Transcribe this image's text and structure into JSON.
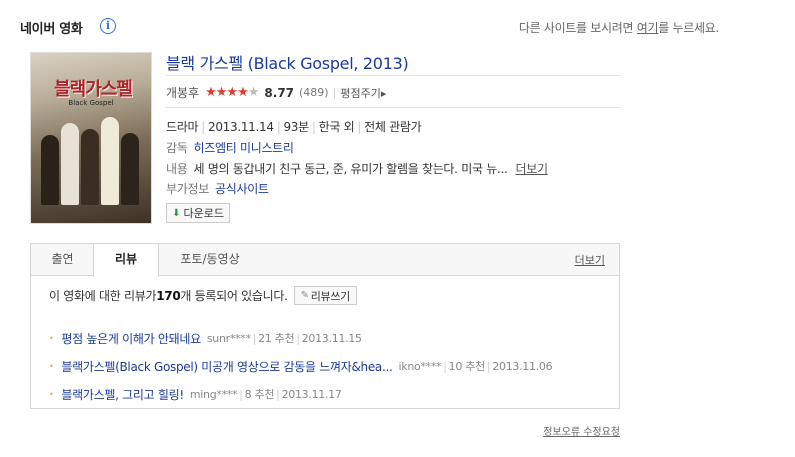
{
  "header": {
    "title": "네이버 영화",
    "info_icon": "i",
    "right_prefix": "다른 사이트를 보시려면 ",
    "right_link": "여기",
    "right_suffix": "를 누르세요."
  },
  "poster": {
    "title": "블랙가스펠",
    "subtitle": "Black Gospel"
  },
  "movie": {
    "title": "블랙 가스펠 (Black Gospel, 2013)",
    "status": "개봉후",
    "stars": "★★★★",
    "half_star": "★",
    "score": "8.77",
    "rating_count": "(489)",
    "rate_link": "평점주기",
    "rate_arrow": "▸",
    "genre": "드라마",
    "release": "2013.11.14",
    "runtime": "93분",
    "country": "한국 외",
    "age": "전체 관람가",
    "director_label": "감독",
    "director": "히즈엠티 미니스트리",
    "summary_label": "내용",
    "summary": "세 명의 동갑내기 친구 동근, 준, 유미가 할렘을 찾는다. 미국 뉴...",
    "summary_more": "더보기",
    "extra_label": "부가정보",
    "extra_link": "공식사이트",
    "download_label": "다운로드",
    "download_icon": "⬇"
  },
  "tabs": {
    "items": [
      "출연",
      "리뷰",
      "포토/동영상"
    ],
    "more": "더보기"
  },
  "reviews": {
    "count_prefix": "이 영화에 대한 리뷰가 ",
    "count": "170",
    "count_suffix": "개 등록되어 있습니다.",
    "write_label": "리뷰쓰기",
    "items": [
      {
        "title": "평점 높은게 이해가 안돼네요",
        "author": "sunr****",
        "recommend": "21 추천",
        "date": "2013.11.15"
      },
      {
        "title": "블랙가스펠(Black Gospel) 미공개 영상으로 감동을 느껴자&hea...",
        "author": "ikno****",
        "recommend": "10 추천",
        "date": "2013.11.06"
      },
      {
        "title": "블랙가스펠, 그리고 힐링!",
        "author": "ming****",
        "recommend": "8 추천",
        "date": "2013.11.17"
      }
    ]
  },
  "footer": {
    "error_link": "정보오류 수정요청"
  }
}
